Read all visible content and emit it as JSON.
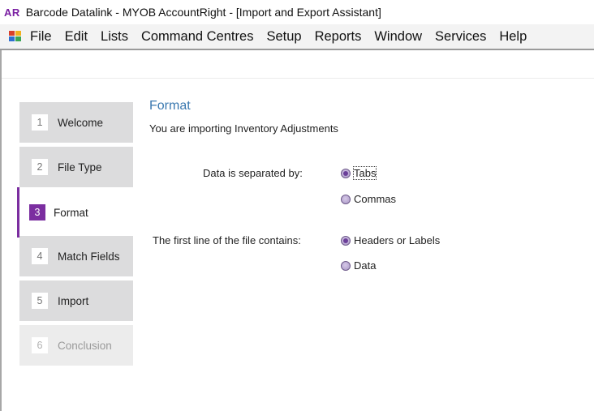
{
  "titlebar": {
    "badge": "AR",
    "title": "Barcode Datalink - MYOB AccountRight - [Import and Export Assistant]"
  },
  "menubar": {
    "items": [
      "File",
      "Edit",
      "Lists",
      "Command Centres",
      "Setup",
      "Reports",
      "Window",
      "Services",
      "Help"
    ]
  },
  "wizard": {
    "steps": [
      {
        "num": "1",
        "label": "Welcome"
      },
      {
        "num": "2",
        "label": "File Type"
      },
      {
        "num": "3",
        "label": "Format"
      },
      {
        "num": "4",
        "label": "Match Fields"
      },
      {
        "num": "5",
        "label": "Import"
      },
      {
        "num": "6",
        "label": "Conclusion"
      }
    ],
    "active_step": 3
  },
  "format": {
    "heading": "Format",
    "subtitle": "You are importing Inventory Adjustments",
    "separator_label": "Data is separated by:",
    "separator_options": [
      "Tabs",
      "Commas"
    ],
    "separator_selected": "Tabs",
    "firstline_label": "The first line of the file contains:",
    "firstline_options": [
      "Headers or Labels",
      "Data"
    ],
    "firstline_selected": "Headers or Labels"
  }
}
